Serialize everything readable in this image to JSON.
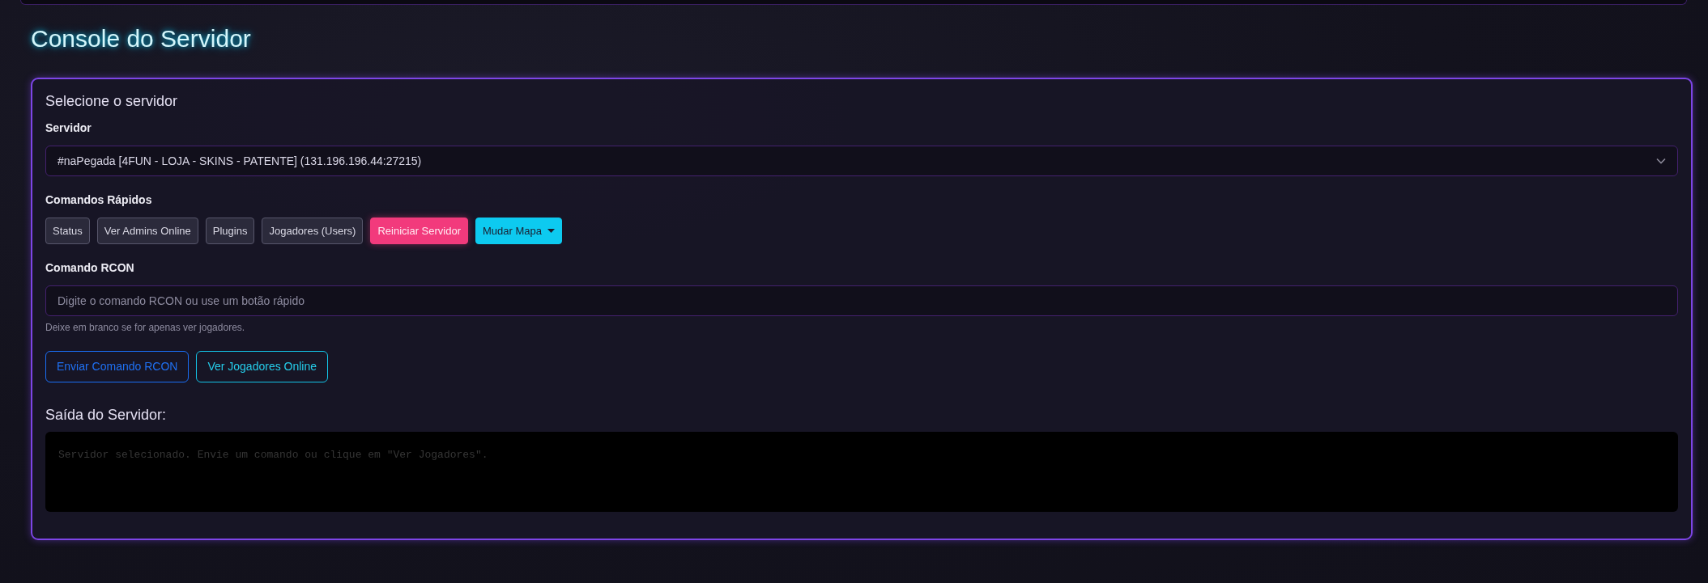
{
  "page_title": "Console do Servidor",
  "card": {
    "heading": "Selecione o servidor",
    "server_field": {
      "label": "Servidor",
      "value": "#naPegada [4FUN - LOJA - SKINS - PATENTE] (131.196.196.44:27215)"
    },
    "quick_commands": {
      "label": "Comandos Rápidos",
      "buttons": [
        {
          "label": "Status",
          "kind": "plain"
        },
        {
          "label": "Ver Admins Online",
          "kind": "plain"
        },
        {
          "label": "Plugins",
          "kind": "plain"
        },
        {
          "label": "Jogadores (Users)",
          "kind": "plain"
        },
        {
          "label": "Reiniciar Servidor",
          "kind": "danger"
        },
        {
          "label": "Mudar Mapa",
          "kind": "dropdown"
        }
      ]
    },
    "rcon_field": {
      "label": "Comando RCON",
      "placeholder": "Digite o comando RCON ou use um botão rápido",
      "help": "Deixe em branco se for apenas ver jogadores."
    },
    "actions": [
      {
        "label": "Enviar Comando RCON",
        "kind": "primary"
      },
      {
        "label": "Ver Jogadores Online",
        "kind": "info"
      }
    ],
    "output": {
      "heading": "Saída do Servidor:",
      "text": "Servidor selecionado. Envie um comando ou clique em \"Ver Jogadores\"."
    }
  }
}
